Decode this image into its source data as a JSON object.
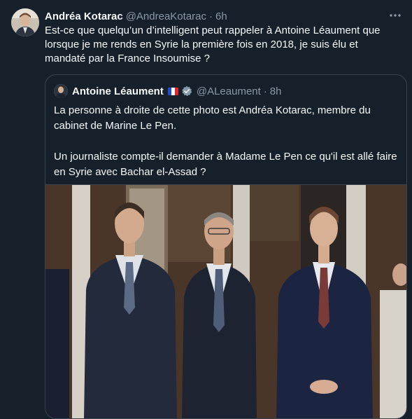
{
  "tweet": {
    "author_name": "Andréa Kotarac",
    "author_handle": "@AndreaKotarac",
    "separator": "·",
    "time": "6h",
    "text": "Est-ce que quelqu’un d’intelligent peut rappeler à Antoine Léaument que lorsque je me rends en Syrie la première fois en 2018, je suis élu et mandaté par la France Insoumise ?",
    "more_icon": "more-horizontal-icon"
  },
  "quoted": {
    "author_name": "Antoine Léaument",
    "flag_icon": "france-flag-icon",
    "verified_icon": "verified-badge-icon",
    "author_handle": "@ALeaument",
    "separator": "·",
    "time": "8h",
    "paragraph1": "La personne à droite de cette photo est Andréa Kotarac, membre du cabinet de Marine Le Pen.",
    "paragraph2": "Un journaliste compte-il demander à Madame Le Pen ce qu'il est allé faire en Syrie avec Bachar el-Assad ?",
    "image_alt": "photo-three-men-in-suits"
  },
  "colors": {
    "background": "#15202b",
    "text": "#f7f9f9",
    "muted": "#8b98a5",
    "border": "#38444d",
    "verified": "#829aab"
  }
}
